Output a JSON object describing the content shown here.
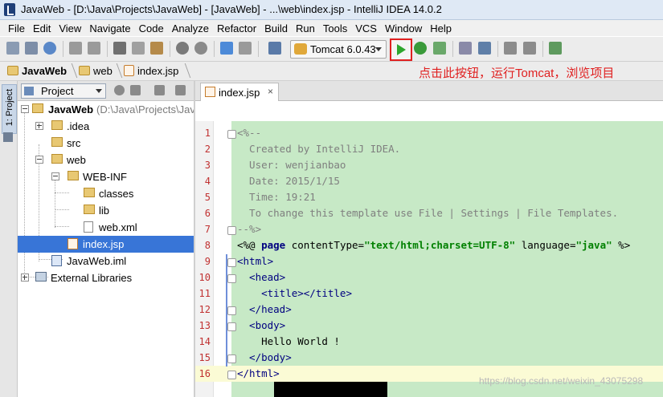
{
  "window": {
    "title": "JavaWeb - [D:\\Java\\Projects\\JavaWeb] - [JavaWeb] - ...\\web\\index.jsp - IntelliJ IDEA 14.0.2"
  },
  "menu": [
    "File",
    "Edit",
    "View",
    "Navigate",
    "Code",
    "Analyze",
    "Refactor",
    "Build",
    "Run",
    "Tools",
    "VCS",
    "Window",
    "Help"
  ],
  "toolbar": {
    "run_config": "Tomcat 6.0.43",
    "icons": [
      "save-icon",
      "sync-icon",
      "undo-icon",
      "redo-icon",
      "cut-icon",
      "copy-icon",
      "paste-icon",
      "find-icon",
      "replace-icon",
      "back-icon",
      "forward-icon",
      "make-icon",
      "run-icon",
      "debug-icon",
      "coverage-icon",
      "settings-icon",
      "project-structure-icon",
      "android-icon",
      "sdk-icon"
    ],
    "run_color": "#2ea62e",
    "highlight_color": "#e02020"
  },
  "breadcrumb": [
    "JavaWeb",
    "web",
    "index.jsp"
  ],
  "annotation": "点击此按钮，运行Tomcat，浏览项目",
  "left_strip": {
    "tab_label": "1: Project"
  },
  "project_panel": {
    "view_mode": "Project",
    "tree": [
      {
        "label": "JavaWeb",
        "path": " (D:\\Java\\Projects\\Jav",
        "icon": "module-icon"
      },
      {
        "label": ".idea",
        "icon": "folder-icon"
      },
      {
        "label": "src",
        "icon": "folder-icon"
      },
      {
        "label": "web",
        "icon": "web-folder-icon"
      },
      {
        "label": "WEB-INF",
        "icon": "folder-icon"
      },
      {
        "label": "classes",
        "icon": "folder-icon"
      },
      {
        "label": "lib",
        "icon": "folder-icon"
      },
      {
        "label": "web.xml",
        "icon": "xml-file-icon"
      },
      {
        "label": "index.jsp",
        "icon": "jsp-file-icon",
        "selected": true
      },
      {
        "label": "JavaWeb.iml",
        "icon": "iml-file-icon"
      },
      {
        "label": "External Libraries",
        "icon": "library-icon"
      }
    ]
  },
  "editor": {
    "tab": "index.jsp",
    "close": "×",
    "current_line": 16,
    "line_numbers": [
      "1",
      "2",
      "3",
      "4",
      "5",
      "6",
      "7",
      "8",
      "9",
      "10",
      "11",
      "12",
      "13",
      "14",
      "15",
      "16"
    ],
    "code": {
      "l1": "<%--",
      "l2": "  Created by IntelliJ IDEA.",
      "l3": "  User: wenjianbao",
      "l4": "  Date: 2015/1/15",
      "l5": "  Time: 19:21",
      "l6": "  To change this template use File | Settings | File Templates.",
      "l7": "--%>",
      "l8": {
        "open": "<%@ ",
        "directive": "page",
        "attr1": " contentType=",
        "val1": "\"text/html;charset=UTF-8\"",
        "attr2": " language=",
        "val2": "\"java\"",
        "close": " %>"
      },
      "l9": "<html>",
      "l10": "  <head>",
      "l11": "    <title></title>",
      "l12": "  </head>",
      "l13": "  <body>",
      "l14": "    Hello World !",
      "l15": "  </body>",
      "l16": "</html>"
    },
    "code_background": "#c7e9c6"
  },
  "watermark": "https://blog.csdn.net/weixin_43075298"
}
